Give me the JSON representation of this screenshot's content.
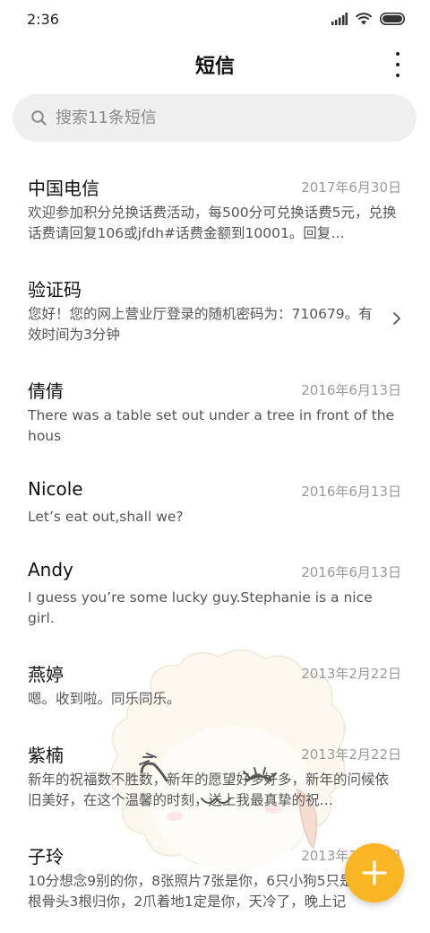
{
  "status_bar": {
    "time": "2:36"
  },
  "header": {
    "title": "短信"
  },
  "search": {
    "placeholder": "搜索11条短信"
  },
  "messages": [
    {
      "name": "中国电信",
      "date": "2017年6月30日",
      "preview": "欢迎参加积分兑换话费活动，每500分可兑换话费5元，兑换话费请回复106或jfdh#话费金额到10001。回复…"
    },
    {
      "name": "验证码",
      "date": "",
      "preview": "您好！您的网上营业厅登录的随机密码为：710679。有效时间为3分钟"
    },
    {
      "name": "倩倩",
      "date": "2016年6月13日",
      "preview": "There was a table set out under a tree in front of the hous"
    },
    {
      "name": "Nicole",
      "date": "2016年6月13日",
      "preview": "Let’s eat out,shall we?"
    },
    {
      "name": "Andy",
      "date": "2016年6月13日",
      "preview": "I guess you’re some lucky guy.Stephanie is a nice girl."
    },
    {
      "name": "燕婷",
      "date": "2013年2月22日",
      "preview": "嗯。收到啦。同乐同乐。"
    },
    {
      "name": "紫楠",
      "date": "2013年2月22日",
      "preview": "新年的祝福数不胜数，新年的愿望好多好多，新年的问候依旧美好，在这个温馨的时刻，送上我最真挚的祝…"
    },
    {
      "name": "子玲",
      "date": "2013年2月22日",
      "preview": "10分想念9别的你，8张照片7张是你，6只小狗5只是你，4根骨头3根归你，2爪着地1定是你，天冷了，晚上记"
    }
  ],
  "colors": {
    "accent": "#f9b523",
    "text_secondary": "#9a9a9a"
  },
  "icons": {
    "fab": "plus-icon",
    "row_arrow": "chevron-right-icon"
  }
}
